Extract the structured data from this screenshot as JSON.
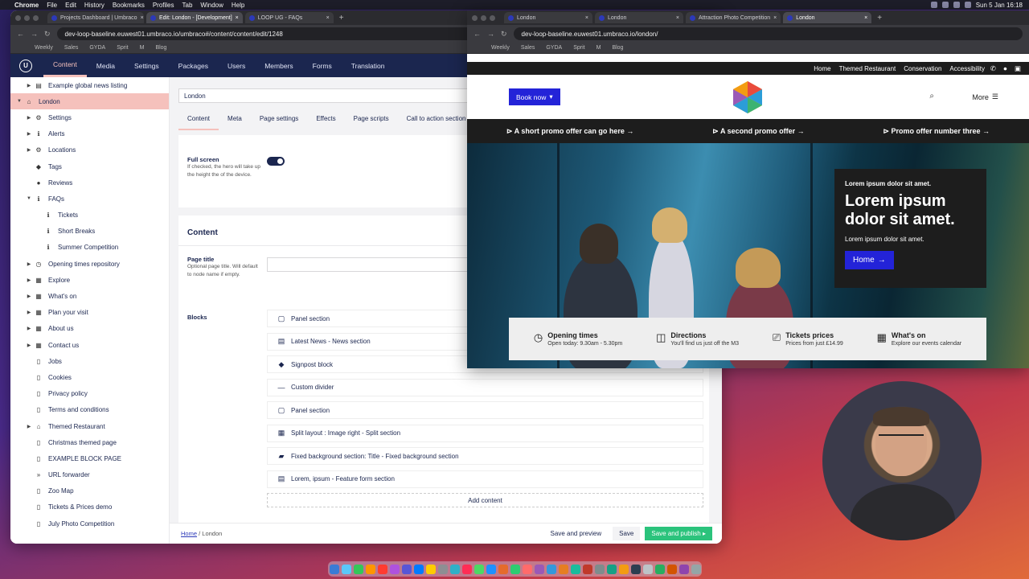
{
  "menubar": {
    "app": "Chrome",
    "items": [
      "File",
      "Edit",
      "History",
      "Bookmarks",
      "Profiles",
      "Tab",
      "Window",
      "Help"
    ],
    "clock": "Sun 5 Jan  16:18"
  },
  "left_browser": {
    "tabs": [
      "Projects Dashboard | Umbraco",
      "Edit: London - [Development]",
      "LOOP UG - FAQs"
    ],
    "url": "dev-loop-baseline.euwest01.umbraco.io/umbraco#/content/content/edit/1248",
    "bookmarks": [
      "Weekly",
      "Sales",
      "GYDA",
      "Sprit",
      "M",
      "Blog"
    ]
  },
  "umbraco": {
    "logo": "U",
    "nav": [
      "Content",
      "Media",
      "Settings",
      "Packages",
      "Users",
      "Members",
      "Forms",
      "Translation"
    ],
    "tree": [
      {
        "label": "Example global news listing",
        "indent": 1,
        "caret": "▶",
        "icon": "▤"
      },
      {
        "label": "London",
        "indent": 0,
        "caret": "▼",
        "icon": "⌂",
        "selected": true
      },
      {
        "label": "Settings",
        "indent": 1,
        "caret": "▶",
        "icon": "⚙"
      },
      {
        "label": "Alerts",
        "indent": 1,
        "caret": "▶",
        "icon": "ℹ"
      },
      {
        "label": "Locations",
        "indent": 1,
        "caret": "▶",
        "icon": "⚙"
      },
      {
        "label": "Tags",
        "indent": 1,
        "caret": "",
        "icon": "◆"
      },
      {
        "label": "Reviews",
        "indent": 1,
        "caret": "",
        "icon": "●"
      },
      {
        "label": "FAQs",
        "indent": 1,
        "caret": "▼",
        "icon": "ℹ"
      },
      {
        "label": "Tickets",
        "indent": 2,
        "caret": "",
        "icon": "ℹ"
      },
      {
        "label": "Short Breaks",
        "indent": 2,
        "caret": "",
        "icon": "ℹ"
      },
      {
        "label": "Summer Competition",
        "indent": 2,
        "caret": "",
        "icon": "ℹ"
      },
      {
        "label": "Opening times repository",
        "indent": 1,
        "caret": "▶",
        "icon": "◷"
      },
      {
        "label": "Explore",
        "indent": 1,
        "caret": "▶",
        "icon": "▦"
      },
      {
        "label": "What's on",
        "indent": 1,
        "caret": "▶",
        "icon": "▦"
      },
      {
        "label": "Plan your visit",
        "indent": 1,
        "caret": "▶",
        "icon": "▦"
      },
      {
        "label": "About us",
        "indent": 1,
        "caret": "▶",
        "icon": "▦"
      },
      {
        "label": "Contact us",
        "indent": 1,
        "caret": "▶",
        "icon": "▦"
      },
      {
        "label": "Jobs",
        "indent": 1,
        "caret": "",
        "icon": "▯"
      },
      {
        "label": "Cookies",
        "indent": 1,
        "caret": "",
        "icon": "▯"
      },
      {
        "label": "Privacy policy",
        "indent": 1,
        "caret": "",
        "icon": "▯"
      },
      {
        "label": "Terms and conditions",
        "indent": 1,
        "caret": "",
        "icon": "▯"
      },
      {
        "label": "Themed Restaurant",
        "indent": 1,
        "caret": "▶",
        "icon": "⌂"
      },
      {
        "label": "Christmas themed page",
        "indent": 1,
        "caret": "",
        "icon": "▯"
      },
      {
        "label": "EXAMPLE BLOCK PAGE",
        "indent": 1,
        "caret": "",
        "icon": "▯"
      },
      {
        "label": "URL forwarder",
        "indent": 1,
        "caret": "",
        "icon": "»"
      },
      {
        "label": "Zoo Map",
        "indent": 1,
        "caret": "",
        "icon": "▯"
      },
      {
        "label": "Tickets & Prices demo",
        "indent": 1,
        "caret": "",
        "icon": "▯"
      },
      {
        "label": "July Photo Competition",
        "indent": 1,
        "caret": "",
        "icon": "▯"
      }
    ],
    "node_name": "London",
    "tabs": [
      "Content",
      "Meta",
      "Page settings",
      "Effects",
      "Page scripts",
      "Call to action section"
    ],
    "fullscreen": {
      "label": "Full screen",
      "desc": "If checked, the hero will take up the height the of the device."
    },
    "content_heading": "Content",
    "page_title": {
      "label": "Page title",
      "desc": "Optional page title. Will default to node name if empty.",
      "value": ""
    },
    "blocks_label": "Blocks",
    "blocks": [
      {
        "icon": "▢",
        "label": "Panel section"
      },
      {
        "icon": "▤",
        "label": "Latest News - News section"
      },
      {
        "icon": "◆",
        "label": "Signpost block"
      },
      {
        "icon": "—",
        "label": "Custom divider"
      },
      {
        "icon": "▢",
        "label": "Panel section"
      },
      {
        "icon": "▦",
        "label": "Split layout : Image right - Split section"
      },
      {
        "icon": "▰",
        "label": "Fixed background section: Title - Fixed background section"
      },
      {
        "icon": "▤",
        "label": "Lorem, ipsum - Feature form section"
      }
    ],
    "add_content": "Add content",
    "breadcrumb": [
      "Home",
      "London"
    ],
    "buttons": {
      "preview": "Save and preview",
      "save": "Save",
      "publish": "Save and publish"
    }
  },
  "right_browser": {
    "tabs": [
      "London",
      "London",
      "Attraction Photo Competition",
      "London"
    ],
    "url": "dev-loop-baseline.euwest01.umbraco.io/london/",
    "bookmarks": [
      "Weekly",
      "Sales",
      "GYDA",
      "Sprit",
      "M",
      "Blog"
    ]
  },
  "site": {
    "topnav": [
      "Home",
      "Themed Restaurant",
      "Conservation",
      "Accessibility"
    ],
    "book": "Book now",
    "more": "More",
    "promos": [
      "A short promo offer can go here →",
      "A second promo offer →",
      "Promo offer number three →"
    ],
    "hero": {
      "eyebrow": "Lorem ipsum dolor sit amet.",
      "title": "Lorem ipsum dolor sit amet.",
      "sub": "Lorem ipsum dolor sit amet.",
      "button": "Home"
    },
    "info": [
      {
        "icon": "◷",
        "title": "Opening times",
        "desc": "Open today: 9.30am - 5.30pm"
      },
      {
        "icon": "◫",
        "title": "Directions",
        "desc": "You'll find us just off the M3"
      },
      {
        "icon": "⎚",
        "title": "Tickets prices",
        "desc": "Prices from just £14.99"
      },
      {
        "icon": "▦",
        "title": "What's on",
        "desc": "Explore our events calendar"
      }
    ]
  }
}
